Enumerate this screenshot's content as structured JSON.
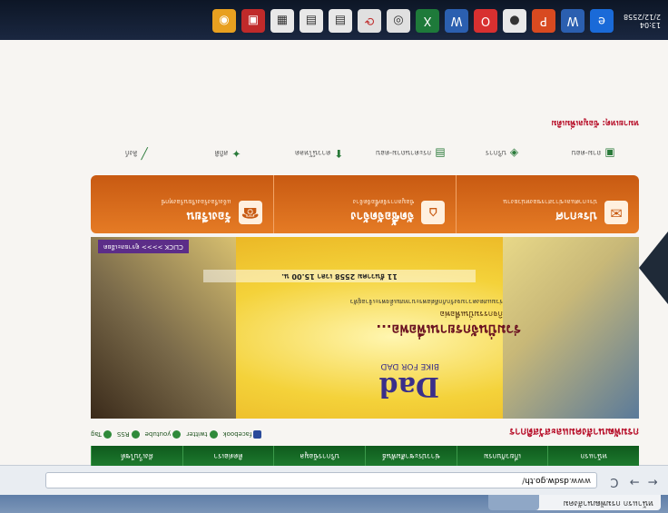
{
  "browser": {
    "active_tab": "หน้าแรก กรมพัฒนาสังคม",
    "inactive_tab": "",
    "url_prefix": "www.",
    "url_host": "dsdw.go.th",
    "url_path": "/",
    "nav": [
      "←",
      "→",
      "C"
    ]
  },
  "site": {
    "nav": [
      "หน้าแรก",
      "เกี่ยวกับกรม",
      "ข่าวประชาสัมพันธ์",
      "บริการข้อมูล",
      "ติดต่อเรา",
      "ผังเว็บไซต์"
    ],
    "title": "กรมพัฒนาสังคมและสวัสดิการ",
    "socials": [
      "facebook",
      "twitter",
      "youtube",
      "RSS",
      "Tag"
    ],
    "logo_main": "Dad",
    "logo_sub": "BIKE FOR DAD",
    "headline": "ร่วมปั่นจักรยานเพื่อพ่อ...",
    "subhead": "กิจกรรมปั่นเพื่อพ่อ",
    "hero_text": "ร่วมแสดงความจงรักภักดีต่อพระบาทสมเด็จพระเจ้าอยู่หัว",
    "event_date": "11 ธันวาคม 2558 เวลา 15.00 น.",
    "click_more": "CLICK >>>> ดูรายละเอียด",
    "services": [
      {
        "icon": "✉",
        "title": "ประกาศ",
        "desc": "ประกาศและข่าวสารของหน่วยงาน"
      },
      {
        "icon": "⌂",
        "title": "จัดซื้อจัดจ้าง",
        "desc": "ข้อมูลการจัดซื้อจัดจ้าง"
      },
      {
        "icon": "☎",
        "title": "ร้องเรียน",
        "desc": "แจ้งเรื่องร้องเรียนร้องทุกข์"
      }
    ],
    "quicklinks": [
      "ถาม-ตอบ",
      "บริการ",
      "กระดานถาม-ตอบ",
      "ดาวน์โหลด",
      "สถิติ",
      "ลิงก์"
    ],
    "bottom_note": "หมายเหตุ: ข้อมูลเพิ่มเติม"
  },
  "taskbar": {
    "clock": "13:04",
    "date": "2/12/2558",
    "icons": [
      "ie",
      "word",
      "excel",
      "pdf",
      "outlook",
      "chrome",
      "media",
      "folder",
      "ppt",
      "ie2"
    ]
  },
  "colors": {
    "nav_green": "#1d7a2e",
    "accent_orange": "#e57b25",
    "title_red": "#b8122c"
  }
}
